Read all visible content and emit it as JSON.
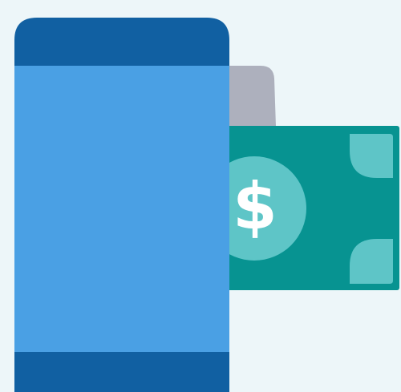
{
  "colors": {
    "background": "#edf6f9",
    "phone_top_bar": "#1160a2",
    "phone_bottom_bar": "#1160a2",
    "phone_screen": "#4aa0e4",
    "card_gray": "#adb0bd",
    "bill_body": "#079391",
    "bill_accent": "#5ec5c7",
    "dollar_symbol": "#ffffff"
  },
  "icons": {
    "phone": "smartphone-icon",
    "card": "card-icon",
    "bill": "dollar-bill-icon"
  },
  "bill": {
    "currency_symbol": "$"
  }
}
